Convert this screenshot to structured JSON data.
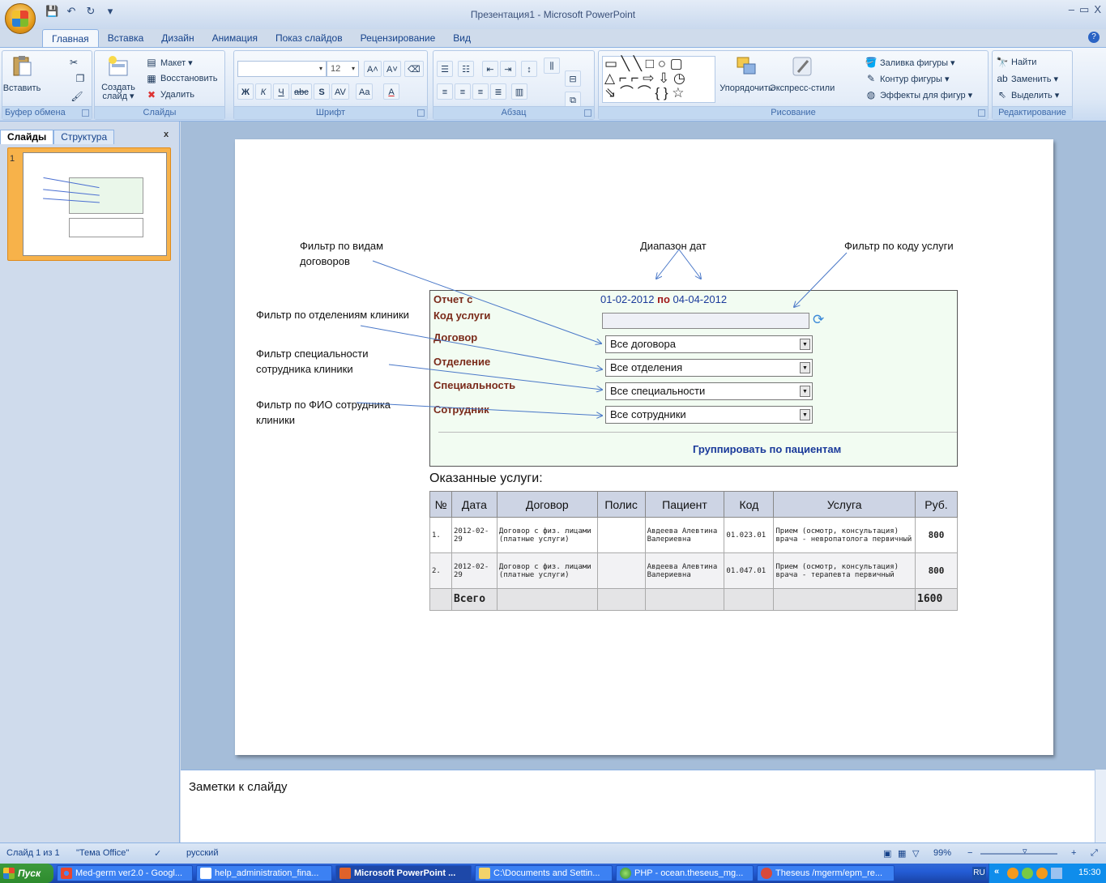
{
  "window": {
    "title": "Презентация1 - Microsoft PowerPoint",
    "minimize": "–",
    "restore": "▭",
    "close": "X"
  },
  "qat": {
    "save": "💾",
    "undo": "↶",
    "redo": "↻",
    "more": "▾"
  },
  "tabs": [
    "Главная",
    "Вставка",
    "Дизайн",
    "Анимация",
    "Показ слайдов",
    "Рецензирование",
    "Вид"
  ],
  "ribbon": {
    "clipboard": {
      "label": "Буфер обмена",
      "paste": "Вставить"
    },
    "slides": {
      "label": "Слайды",
      "new_slide": "Создать слайд ▾",
      "layout": "Макет ▾",
      "reset": "Восстановить",
      "delete": "Удалить"
    },
    "font": {
      "label": "Шрифт",
      "font_size": "12",
      "bold": "Ж",
      "italic": "К",
      "underline": "Ч",
      "strike": "abc",
      "shadow": "S",
      "spacing": "AV",
      "case": "Aa",
      "color": "A",
      "grow": "A",
      "shrink": "A"
    },
    "paragraph": {
      "label": "Абзац"
    },
    "drawing": {
      "label": "Рисование",
      "arrange": "Упорядочить",
      "quick_styles": "Экспресс-стили",
      "fill": "Заливка фигуры ▾",
      "outline": "Контур фигуры ▾",
      "effects": "Эффекты для фигур ▾"
    },
    "editing": {
      "label": "Редактирование",
      "find": "Найти",
      "replace": "Заменить ▾",
      "select": "Выделить ▾"
    }
  },
  "left_pane": {
    "tab_slides": "Слайды",
    "tab_outline": "Структура",
    "close": "x",
    "slide_number": "1"
  },
  "slide": {
    "annotations": {
      "contract_filter": "Фильтр по видам договоров",
      "date_range": "Диапазон дат",
      "service_code_filter": "Фильтр по коду услуги",
      "department_filter": "Фильтр по отделениям клиники",
      "specialty_filter": "Фильтр специальности сотрудника клиники",
      "employee_filter": "Фильтр по ФИО сотрудника клиники"
    },
    "report": {
      "report_from": "Отчет с",
      "date_from": "01-02-2012",
      "date_to_word": "по",
      "date_to": "04-04-2012",
      "service_code_label": "Код услуги",
      "contract_label": "Договор",
      "contract_value": "Все договора",
      "department_label": "Отделение",
      "department_value": "Все отделения",
      "specialty_label": "Специальность",
      "specialty_value": "Все специальности",
      "employee_label": "Сотрудник",
      "employee_value": "Все сотрудники",
      "group_link": "Группировать по пациентам"
    },
    "services_title": "Оказанные услуги:",
    "table": {
      "headers": [
        "№",
        "Дата",
        "Договор",
        "Полис",
        "Пациент",
        "Код",
        "Услуга",
        "Руб."
      ],
      "rows": [
        [
          "1.",
          "2012-02-29",
          "Договор с физ. лицами (платные услуги)",
          "",
          "Авдеева Алевтина Валериевна",
          "01.023.01",
          "Прием (осмотр, консультация) врача - невропатолога первичный",
          "800"
        ],
        [
          "2.",
          "2012-02-29",
          "Договор с физ. лицами (платные услуги)",
          "",
          "Авдеева Алевтина Валериевна",
          "01.047.01",
          "Прием (осмотр, консультация) врача - терапевта первичный",
          "800"
        ]
      ],
      "total_label": "Всего",
      "total_value": "1600"
    }
  },
  "notes_placeholder": "Заметки к слайду",
  "statusbar": {
    "slide_of": "Слайд 1 из 1",
    "theme": "\"Тема Office\"",
    "language": "русский",
    "zoom": "99%",
    "zoom_minus": "−",
    "zoom_plus": "+"
  },
  "taskbar": {
    "start": "Пуск",
    "tasks": [
      "Med-germ ver2.0 - Googl...",
      "help_administration_fina...",
      "Microsoft PowerPoint ...",
      "C:\\Documents and Settin...",
      "PHP - ocean.theseus_mg...",
      "Theseus /mgerm/epm_re..."
    ],
    "lang": "RU",
    "tray_arrows": "«",
    "clock": "15:30"
  }
}
